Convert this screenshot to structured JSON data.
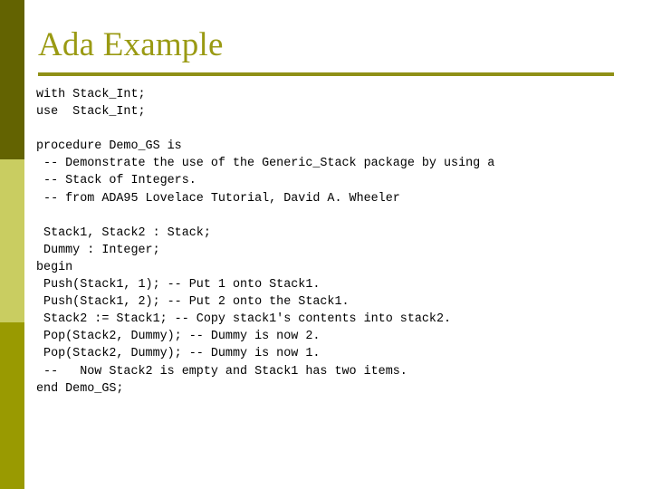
{
  "slide": {
    "title": "Ada Example",
    "colors": {
      "title_text": "#9a9a13",
      "title_rule": "#8f9016",
      "band_top": "#636301",
      "band_middle": "#c9cd61",
      "band_bottom": "#999a01",
      "background": "#ffffff",
      "code_text": "#000000"
    },
    "code_lines": [
      "with Stack_Int;",
      "use  Stack_Int;",
      "",
      "procedure Demo_GS is",
      " -- Demonstrate the use of the Generic_Stack package by using a",
      " -- Stack of Integers.",
      " -- from ADA95 Lovelace Tutorial, David A. Wheeler",
      "",
      " Stack1, Stack2 : Stack;",
      " Dummy : Integer;",
      "begin",
      " Push(Stack1, 1); -- Put 1 onto Stack1.",
      " Push(Stack1, 2); -- Put 2 onto the Stack1.",
      " Stack2 := Stack1; -- Copy stack1's contents into stack2.",
      " Pop(Stack2, Dummy); -- Dummy is now 2.",
      " Pop(Stack2, Dummy); -- Dummy is now 1.",
      " --   Now Stack2 is empty and Stack1 has two items.",
      "end Demo_GS;"
    ]
  }
}
